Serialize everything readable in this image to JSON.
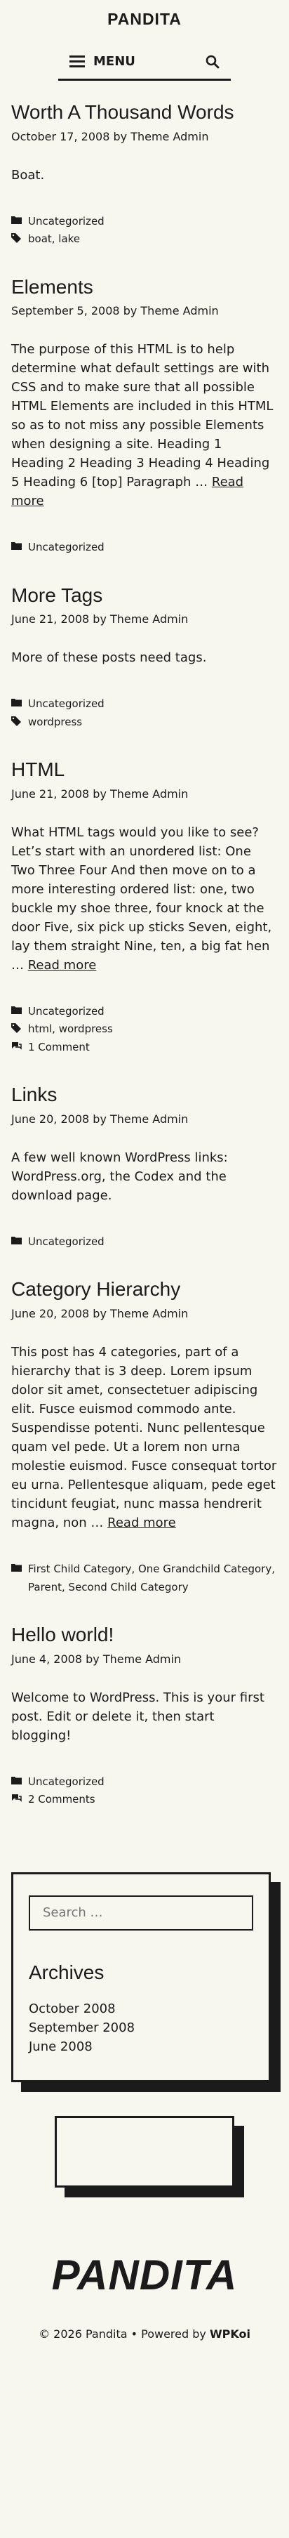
{
  "site": {
    "title": "PANDITA"
  },
  "nav": {
    "menu_label": "MENU"
  },
  "posts": [
    {
      "title": "Worth A Thousand Words",
      "date": "October 17, 2008",
      "by": "by",
      "author": "Theme Admin",
      "excerpt": "Boat.",
      "categories": "Uncategorized",
      "tags": "boat, lake"
    },
    {
      "title": "Elements",
      "date": "September 5, 2008",
      "by": "by",
      "author": "Theme Admin",
      "excerpt": "The purpose of this HTML is to help determine what default settings are with CSS and to make sure that all possible HTML Elements are included in this HTML so as to not miss any possible Elements when designing a site. Heading 1 Heading 2 Heading 3 Heading 4 Heading 5 Heading 6 [top] Paragraph … ",
      "read_more": "Read more",
      "categories": "Uncategorized"
    },
    {
      "title": "More Tags",
      "date": "June 21, 2008",
      "by": "by",
      "author": "Theme Admin",
      "excerpt": "More of these posts need tags.",
      "categories": "Uncategorized",
      "tags": "wordpress"
    },
    {
      "title": "HTML",
      "date": "June 21, 2008",
      "by": "by",
      "author": "Theme Admin",
      "excerpt": "What HTML tags would you like to see? Let’s start with an unordered list: One Two Three Four And then move on to a more interesting ordered list: one, two buckle my shoe three, four knock at the door Five, six pick up sticks Seven, eight, lay them straight Nine, ten, a big fat hen … ",
      "read_more": "Read more",
      "categories": "Uncategorized",
      "tags": "html, wordpress",
      "comments": "1 Comment"
    },
    {
      "title": "Links",
      "date": "June 20, 2008",
      "by": "by",
      "author": "Theme Admin",
      "excerpt": "A few well known WordPress links: WordPress.org, the Codex and the download page.",
      "categories": "Uncategorized"
    },
    {
      "title": "Category Hierarchy",
      "date": "June 20, 2008",
      "by": "by",
      "author": "Theme Admin",
      "excerpt": "This post has 4 categories, part of a hierarchy that is 3 deep. Lorem ipsum dolor sit amet, consectetuer adipiscing elit. Fusce euismod commodo ante. Suspendisse potenti. Nunc pellentesque quam vel pede. Ut a lorem non urna molestie euismod. Fusce consequat tortor eu urna. Pellentesque aliquam, pede eget tincidunt feugiat, nunc massa hendrerit magna, non … ",
      "read_more": "Read more",
      "categories": "First Child Category, One Grandchild Category, Parent, Second Child Category"
    },
    {
      "title": "Hello world!",
      "date": "June 4, 2008",
      "by": "by",
      "author": "Theme Admin",
      "excerpt": "Welcome to WordPress. This is your first post. Edit or delete it, then start blogging!",
      "categories": "Uncategorized",
      "comments": "2 Comments"
    }
  ],
  "sidebar": {
    "search_placeholder": "Search …",
    "archives_title": "Archives",
    "archives": [
      "October 2008",
      "September 2008",
      "June 2008"
    ]
  },
  "footer": {
    "logo_text": "PANDITA",
    "copyright_prefix": "© 2026 Pandita • Powered by ",
    "powered_by": "WPKoi"
  },
  "colors": {
    "ink": "#1b1b1b",
    "background": "#f7f6ef"
  }
}
